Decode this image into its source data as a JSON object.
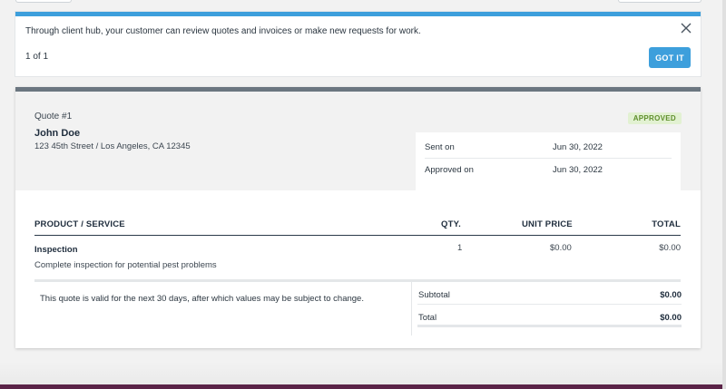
{
  "notice": {
    "text": "Through client hub, your customer can review quotes and invoices or make new requests for work.",
    "count": "1 of 1",
    "button_label": "GOT IT",
    "accent_color": "#3d9fdc"
  },
  "quote": {
    "number": "Quote #1",
    "status": "APPROVED",
    "client_name": "John Doe",
    "client_address": "123 45th Street / Los Angeles, CA 12345",
    "dates": [
      {
        "label": "Sent on",
        "value": "Jun 30, 2022"
      },
      {
        "label": "Approved on",
        "value": "Jun 30, 2022"
      }
    ]
  },
  "table": {
    "headers": {
      "product": "PRODUCT / SERVICE",
      "qty": "QTY.",
      "unit_price": "UNIT PRICE",
      "total": "TOTAL"
    },
    "items": [
      {
        "name": "Inspection",
        "description": "Complete inspection for potential pest problems",
        "qty": "1",
        "unit_price": "$0.00",
        "total": "$0.00"
      }
    ]
  },
  "terms": "This quote is valid for the next 30 days, after which values may be subject to change.",
  "summary": {
    "subtotal_label": "Subtotal",
    "subtotal_value": "$0.00",
    "total_label": "Total",
    "total_value": "$0.00"
  }
}
